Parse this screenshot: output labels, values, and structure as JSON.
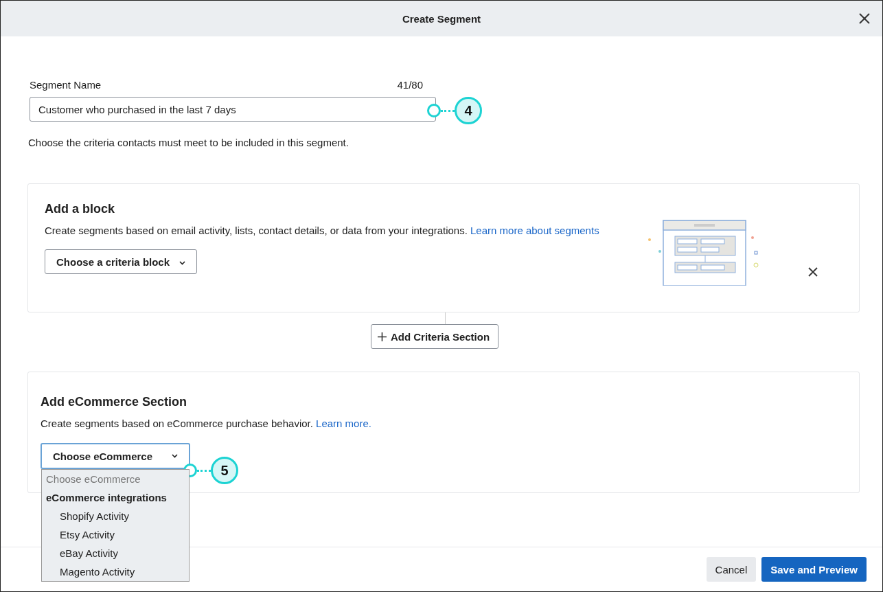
{
  "dialog": {
    "title": "Create Segment"
  },
  "segment_name": {
    "label": "Segment Name",
    "counter": "41/80",
    "value": "Customer who purchased in the last 7 days",
    "callout": "4"
  },
  "instructions": "Choose the criteria contacts must meet to be included in this segment.",
  "block": {
    "title": "Add a block",
    "description": "Create segments based on email activity, lists, contact details, or data from your integrations.",
    "link": "Learn more about segments",
    "dropdown": "Choose a criteria block"
  },
  "add_section_button": "Add Criteria Section",
  "ecommerce": {
    "title": "Add eCommerce Section",
    "description": "Create segments based on eCommerce purchase behavior.",
    "link": "Learn more.",
    "dropdown": "Choose eCommerce",
    "callout": "5",
    "expanded": true,
    "options": [
      {
        "kind": "placeholder",
        "label": "Choose eCommerce"
      },
      {
        "kind": "group",
        "label": "eCommerce integrations"
      },
      {
        "kind": "option",
        "label": "Shopify Activity"
      },
      {
        "kind": "option",
        "label": "Etsy Activity"
      },
      {
        "kind": "option",
        "label": "eBay Activity"
      },
      {
        "kind": "option",
        "label": "Magento Activity"
      }
    ]
  },
  "buttons": [
    {
      "kind": "secondary",
      "label": "Cancel"
    },
    {
      "kind": "primary",
      "label": "Save and Preview"
    }
  ]
}
